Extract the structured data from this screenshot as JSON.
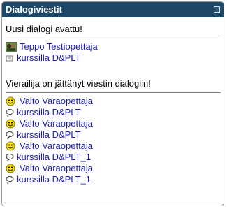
{
  "block": {
    "title": "Dialogiviestit"
  },
  "new_dialog": {
    "heading": "Uusi dialogi avattu!",
    "user_name": "Teppo Testiopettaja",
    "course_line": "kurssilla D&PLT"
  },
  "visitor_messages": {
    "heading": "Vierailija on jättänyt viestin dialogiin!",
    "items": [
      {
        "user_name": "Valto Varaopettaja",
        "course_line": "kurssilla D&PLT"
      },
      {
        "user_name": "Valto Varaopettaja",
        "course_line": "kurssilla D&PLT"
      },
      {
        "user_name": "Valto Varaopettaja",
        "course_line": "kurssilla D&PLT_1"
      },
      {
        "user_name": "Valto Varaopettaja",
        "course_line": "kurssilla D&PLT_1"
      }
    ]
  },
  "colors": {
    "header_bg": "#1c4766",
    "link": "#1c1cb0"
  },
  "icons": {
    "user_photo": "user-photo-icon",
    "course": "course-icon",
    "smiley": "smiley-icon",
    "message": "speech-bubble-icon",
    "hide": "hide-block-icon"
  }
}
